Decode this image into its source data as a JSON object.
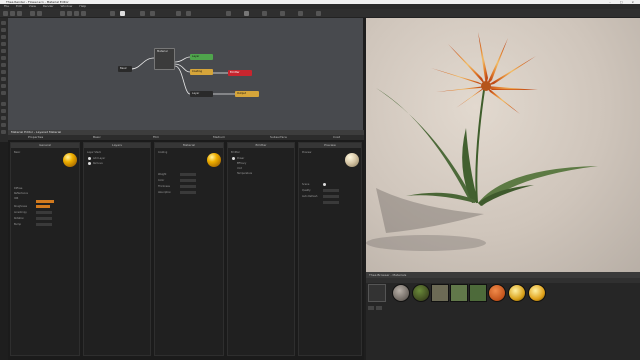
{
  "window": {
    "title": "Thea Render - Flower.scn - Material Editor"
  },
  "menu": [
    "File",
    "Edit",
    "View",
    "Render",
    "Window",
    "Help"
  ],
  "graph_nodes": [
    {
      "id": "source",
      "label": "Basic"
    },
    {
      "id": "mixer",
      "label": "Material"
    },
    {
      "id": "green",
      "label": "Layer"
    },
    {
      "id": "yellow1",
      "label": "Coating"
    },
    {
      "id": "red",
      "label": "Emitter"
    },
    {
      "id": "dark",
      "label": "Layer"
    },
    {
      "id": "yellow2",
      "label": "Output"
    }
  ],
  "bottom_panel": {
    "header": "Material Editor - Layered Material",
    "tabs": [
      "Properties",
      "Basic",
      "Film",
      "Medium",
      "Subsurface",
      "Coat"
    ],
    "columns": [
      {
        "title": "General",
        "name": "Basic",
        "rows": [
          "Diffuse",
          "Reflectance",
          "IOR",
          "Roughness",
          "Anisotropy",
          "Rotation",
          "Bump"
        ]
      },
      {
        "title": "Layers",
        "name": "Layer Stack",
        "rows": [
          "Add Layer",
          "Remove"
        ]
      },
      {
        "title": "Material",
        "name": "Coating",
        "rows": [
          "Weight",
          "Color",
          "Thickness",
          "Absorption"
        ]
      },
      {
        "title": "Emitter",
        "name": "Emitter",
        "rows": [
          "Power",
          "Efficacy",
          "Unit",
          "Temperature"
        ]
      },
      {
        "title": "Preview",
        "name": "Preview",
        "rows": [
          "Scene",
          "Quality",
          "Auto Refresh"
        ]
      }
    ]
  },
  "browser": {
    "header": "Thea Browser - Materials",
    "swatch_colors": [
      "#e6e6e6",
      "#8a8178",
      "#3f4a20",
      "#6c6a55",
      "#61784a",
      "#4d6a3a",
      "#c2531b",
      "#d9a21c",
      "#e1a21b"
    ]
  },
  "colors": {
    "orange": "#d27a1e",
    "green": "#4fa54c",
    "red": "#c8252e",
    "yellow": "#d6a53a"
  }
}
